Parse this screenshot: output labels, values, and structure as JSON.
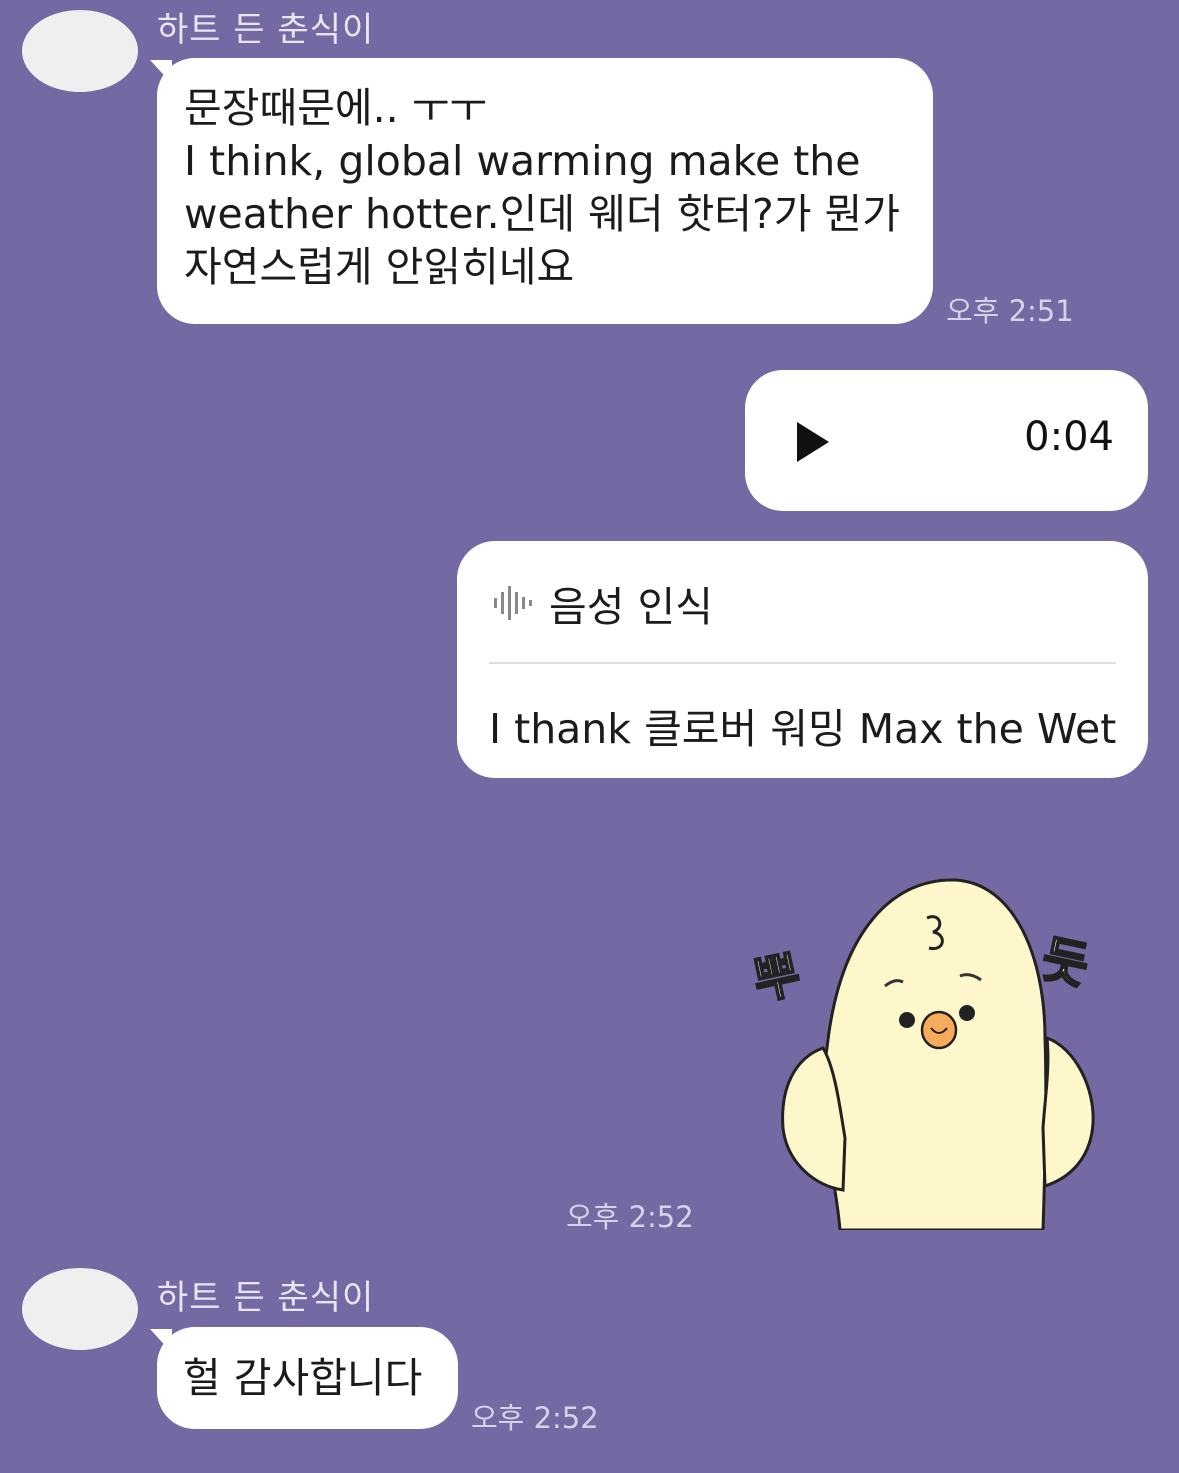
{
  "colors": {
    "background": "#7469a2",
    "bubble": "#ffffff",
    "time": "#d7d3e6"
  },
  "messages": [
    {
      "sender": "하트 든 춘식이",
      "text": "문장때문에.. ㅜㅜ\nI think, global warming make the\nweather hotter.인데 웨더 핫터?가 뭔가\n자연스럽게 안읽히네요",
      "time": "오후 2:51"
    },
    {
      "voice": {
        "play_icon": "play-icon",
        "duration": "0:04"
      }
    },
    {
      "transcript": {
        "icon": "sound-wave-icon",
        "label": "음성 인식",
        "text": "I thank 클로버 워밍 Max the Wet"
      }
    },
    {
      "sticker": {
        "icon": "chick-sticker",
        "left_text": "뿌",
        "right_text": "듯"
      },
      "time": "오후 2:52"
    },
    {
      "sender": "하트 든 춘식이",
      "text": "헐 감사합니다",
      "time": "오후 2:52"
    }
  ]
}
